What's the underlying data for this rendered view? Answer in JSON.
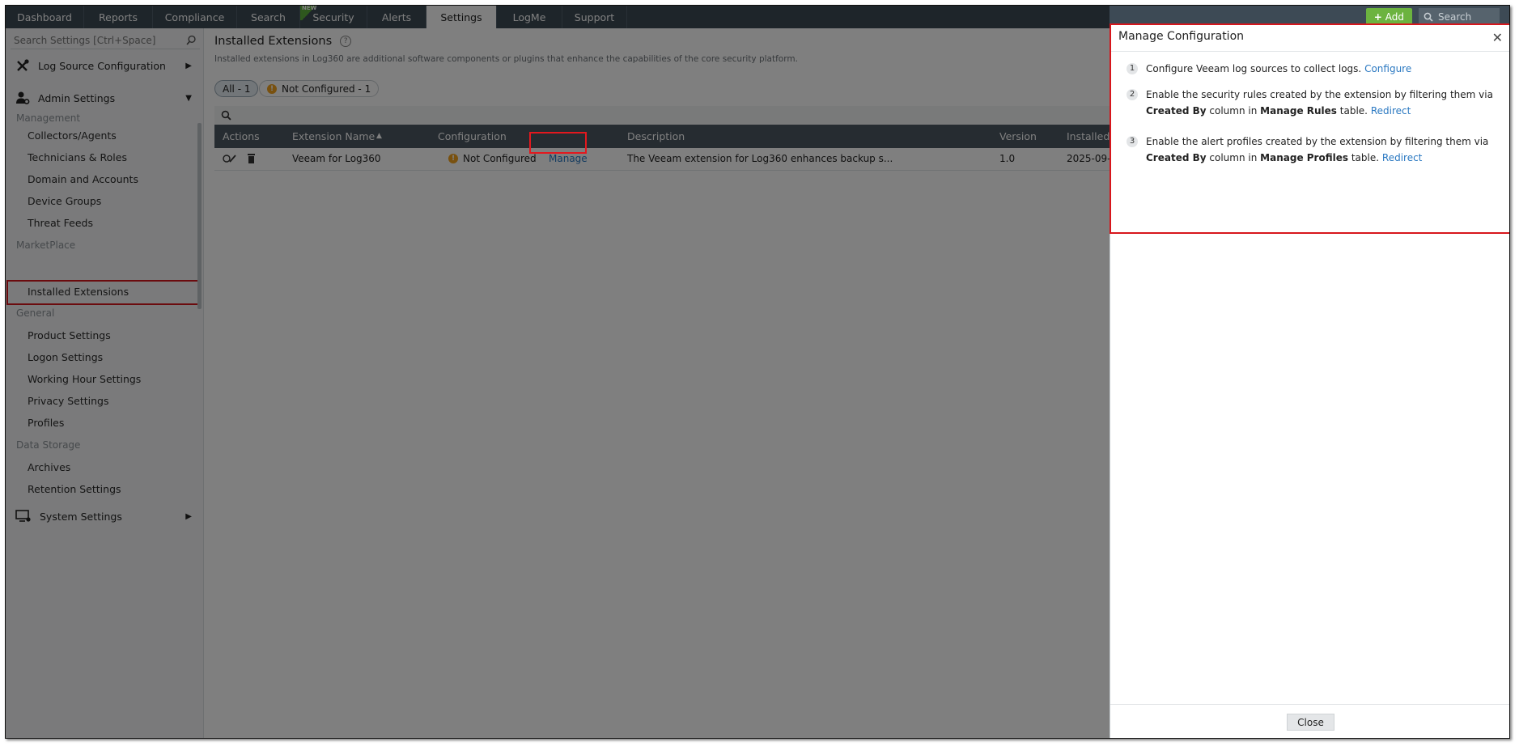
{
  "nav": {
    "tabs": [
      "Dashboard",
      "Reports",
      "Compliance",
      "Search",
      "Security",
      "Alerts",
      "Settings",
      "LogMe",
      "Support"
    ],
    "new_badge": "NEW",
    "add_label": "Add",
    "search_placeholder": "Search"
  },
  "sidebar": {
    "search_placeholder": "Search Settings [Ctrl+Space]",
    "log_source": "Log Source Configuration",
    "admin": "Admin Settings",
    "sections": {
      "management": "Management",
      "marketplace": "MarketPlace",
      "general": "General",
      "data_storage": "Data Storage"
    },
    "management_items": [
      "Collectors/Agents",
      "Technicians & Roles",
      "Domain and Accounts",
      "Device Groups",
      "Threat Feeds"
    ],
    "marketplace_items": [
      "Installed Extensions"
    ],
    "general_items": [
      "Product Settings",
      "Logon Settings",
      "Working Hour Settings",
      "Privacy Settings",
      "Profiles"
    ],
    "data_storage_items": [
      "Archives",
      "Retention Settings"
    ],
    "system": "System Settings"
  },
  "page": {
    "title": "Installed Extensions",
    "subtitle": "Installed extensions in Log360 are additional software components or plugins that enhance the capabilities of the core security platform.",
    "filter_all": "All - 1",
    "filter_not_configured": "Not Configured - 1"
  },
  "table": {
    "headers": [
      "Actions",
      "Extension Name",
      "Configuration",
      "Description",
      "Version",
      "Installed"
    ],
    "row": {
      "name": "Veeam for Log360",
      "config_status": "Not Configured",
      "config_link": "Manage",
      "description": "The Veeam extension for Log360 enhances backup s...",
      "version": "1.0",
      "installed": "2025-09-"
    }
  },
  "panel": {
    "title": "Manage Configuration",
    "steps": [
      {
        "num": "1",
        "text": "Configure Veeam log sources to collect logs.",
        "link": "Configure"
      },
      {
        "num": "2",
        "pre": "Enable the security rules created by the extension by filtering them via",
        "b1": "Created By",
        "mid": "column in",
        "b2": "Manage Rules",
        "post": "table.",
        "link": "Redirect"
      },
      {
        "num": "3",
        "pre": "Enable the alert profiles created by the extension by filtering them via",
        "b1": "Created By",
        "mid": "column in",
        "b2": "Manage Profiles",
        "post": "table.",
        "link": "Redirect"
      }
    ],
    "close_label": "Close"
  }
}
